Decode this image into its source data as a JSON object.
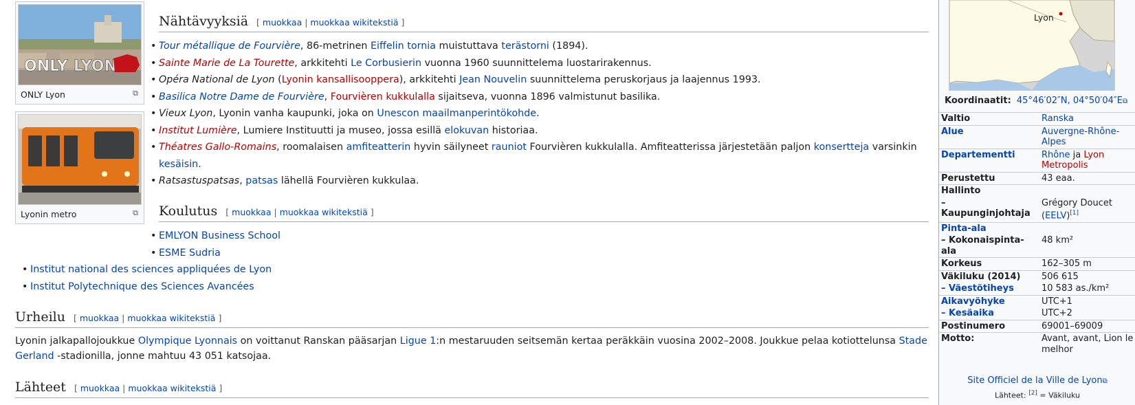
{
  "images": [
    {
      "caption": "ONLY Lyon"
    },
    {
      "caption": "Lyonin metro"
    }
  ],
  "edit_links": {
    "edit": "muokkaa",
    "sep": "|",
    "edit_source": "muokkaa wikitekstiä",
    "open": "[",
    "close": "]"
  },
  "sections": {
    "sights": {
      "title": "Nähtävyyksiä",
      "items": [
        [
          {
            "t": "Tour métallique de Fourvière",
            "c": "link ital"
          },
          {
            "t": ", 86-metrinen "
          },
          {
            "t": "Eiffelin tornia",
            "c": "link"
          },
          {
            "t": " muistuttava "
          },
          {
            "t": "terästorni",
            "c": "link"
          },
          {
            "t": " (1894)."
          }
        ],
        [
          {
            "t": "Sainte Marie de La Tourette",
            "c": "red ital"
          },
          {
            "t": ", arkkitehti "
          },
          {
            "t": "Le Corbusierin",
            "c": "link"
          },
          {
            "t": " vuonna 1960 suunnittelema luostarirakennus."
          }
        ],
        [
          {
            "t": "Opéra National de Lyon",
            "c": "ital"
          },
          {
            "t": " ("
          },
          {
            "t": "Lyonin kansallisooppera",
            "c": "red"
          },
          {
            "t": "), arkkitehti "
          },
          {
            "t": "Jean Nouvelin",
            "c": "link"
          },
          {
            "t": " suunnittelema peruskorjaus ja laajennus 1993."
          }
        ],
        [
          {
            "t": "Basilica Notre Dame de Fourvière",
            "c": "link ital"
          },
          {
            "t": ", "
          },
          {
            "t": "Fourvièren kukkulalla",
            "c": "red"
          },
          {
            "t": " sijaitseva, vuonna 1896 valmistunut basilika."
          }
        ],
        [
          {
            "t": "Vieux Lyon",
            "c": "ital"
          },
          {
            "t": ", Lyonin vanha kaupunki, joka on "
          },
          {
            "t": "Unescon maailmanperintökohde",
            "c": "link"
          },
          {
            "t": "."
          }
        ],
        [
          {
            "t": "Institut Lumière",
            "c": "red ital"
          },
          {
            "t": ", Lumiere Instituutti ja museo, jossa esillä "
          },
          {
            "t": "elokuvan",
            "c": "link"
          },
          {
            "t": " historiaa."
          }
        ],
        [
          {
            "t": "Théatres Gallo-Romains",
            "c": "red ital"
          },
          {
            "t": ", roomalaisen "
          },
          {
            "t": "amfiteatterin",
            "c": "link"
          },
          {
            "t": " hyvin säilyneet "
          },
          {
            "t": "rauniot",
            "c": "link"
          },
          {
            "t": " Fourvièren kukkulalla. Amfiteatterissa järjestetään paljon "
          },
          {
            "t": "konsertteja",
            "c": "link"
          },
          {
            "t": " varsinkin "
          },
          {
            "t": "kesäisin",
            "c": "link"
          },
          {
            "t": "."
          }
        ],
        [
          {
            "t": "Ratsastuspatsas",
            "c": "ital"
          },
          {
            "t": ", "
          },
          {
            "t": "patsas",
            "c": "link"
          },
          {
            "t": " lähellä Fourvièren kukkulaa."
          }
        ]
      ]
    },
    "education": {
      "title": "Koulutus",
      "items_inner": [
        "EMLYON Business School",
        "ESME Sudria"
      ],
      "items_outer": [
        "Institut national des sciences appliquées de Lyon",
        "Institut Polytechnique des Sciences Avancées"
      ]
    },
    "sports": {
      "title": "Urheilu",
      "para": [
        {
          "t": "Lyonin jalkapallojoukkue "
        },
        {
          "t": "Olympique Lyonnais",
          "c": "link"
        },
        {
          "t": " on voittanut Ranskan pääsarjan "
        },
        {
          "t": "Ligue 1",
          "c": "link"
        },
        {
          "t": ":n mestaruuden seitsemän kertaa peräkkäin vuosina 2002–2008. Joukkue pelaa kotiottelunsa "
        },
        {
          "t": "Stade Gerland",
          "c": "link"
        },
        {
          "t": " -stadionilla, jonne mahtuu 43 051 katsojaa."
        }
      ]
    },
    "sources": {
      "title": "Lähteet"
    }
  },
  "infobox": {
    "map_label": "Lyon",
    "coords_label": "Koordinaatit:",
    "coords_value": "45°46′02″N, 04°50′04″E",
    "rows": [
      {
        "k": "Valtio",
        "v": [
          {
            "t": "Ranska",
            "c": "link"
          }
        ]
      },
      {
        "k": "Alue",
        "kc": "link",
        "v": [
          {
            "t": "Auvergne-Rhône-Alpes",
            "c": "link"
          }
        ]
      },
      {
        "k": "Departementti",
        "kc": "link",
        "v": [
          {
            "t": "Rhône",
            "c": "link"
          },
          {
            "t": " ja "
          },
          {
            "t": "Lyon Metropolis",
            "c": "red"
          }
        ]
      },
      {
        "k": "Perustettu",
        "v": [
          {
            "t": "43 eaa."
          }
        ]
      },
      {
        "k": "Hallinto",
        "v": [],
        "nob": true
      },
      {
        "k": " – Kaupunginjohtaja",
        "v": [
          {
            "t": "Grégory Doucet ("
          },
          {
            "t": "EELV",
            "c": "link"
          },
          {
            "t": ")"
          },
          {
            "t": "[1]",
            "c": "link sup"
          }
        ],
        "sub": true
      },
      {
        "k": "Pinta-ala",
        "kc": "link",
        "v": []
      },
      {
        "k": " – Kokonaispinta-ala",
        "v": [
          {
            "t": "48 km²"
          }
        ],
        "sub": true
      },
      {
        "k": "Korkeus",
        "v": [
          {
            "t": "162–305 m"
          }
        ]
      },
      {
        "k": "Väkiluku (2014)",
        "v": [
          {
            "t": "506 615"
          }
        ]
      },
      {
        "k": " – Väestötiheys",
        "kc": "link",
        "v": [
          {
            "t": "10 583 as./km²"
          }
        ],
        "sub": true
      },
      {
        "k": "Aikavyöhyke",
        "kc": "link",
        "v": [
          {
            "t": "UTC+1"
          }
        ]
      },
      {
        "k": " – Kesäaika",
        "kc": "link",
        "v": [
          {
            "t": "UTC+2"
          }
        ],
        "sub": true
      },
      {
        "k": "Postinumero",
        "v": [
          {
            "t": "69001–69009"
          }
        ]
      },
      {
        "k": "Motto:",
        "v": [
          {
            "t": "Avant, avant, Lion le melhor"
          }
        ]
      }
    ],
    "website": "Site Officiel de la Ville de Lyon",
    "sources_note_prefix": "Lähteet: ",
    "sources_note_ref": "[2]",
    "sources_note_suffix": " = Väkiluku"
  },
  "colors": {
    "link": "#0645ad",
    "redlink": "#ba0000",
    "border": "#a2a9b1"
  }
}
